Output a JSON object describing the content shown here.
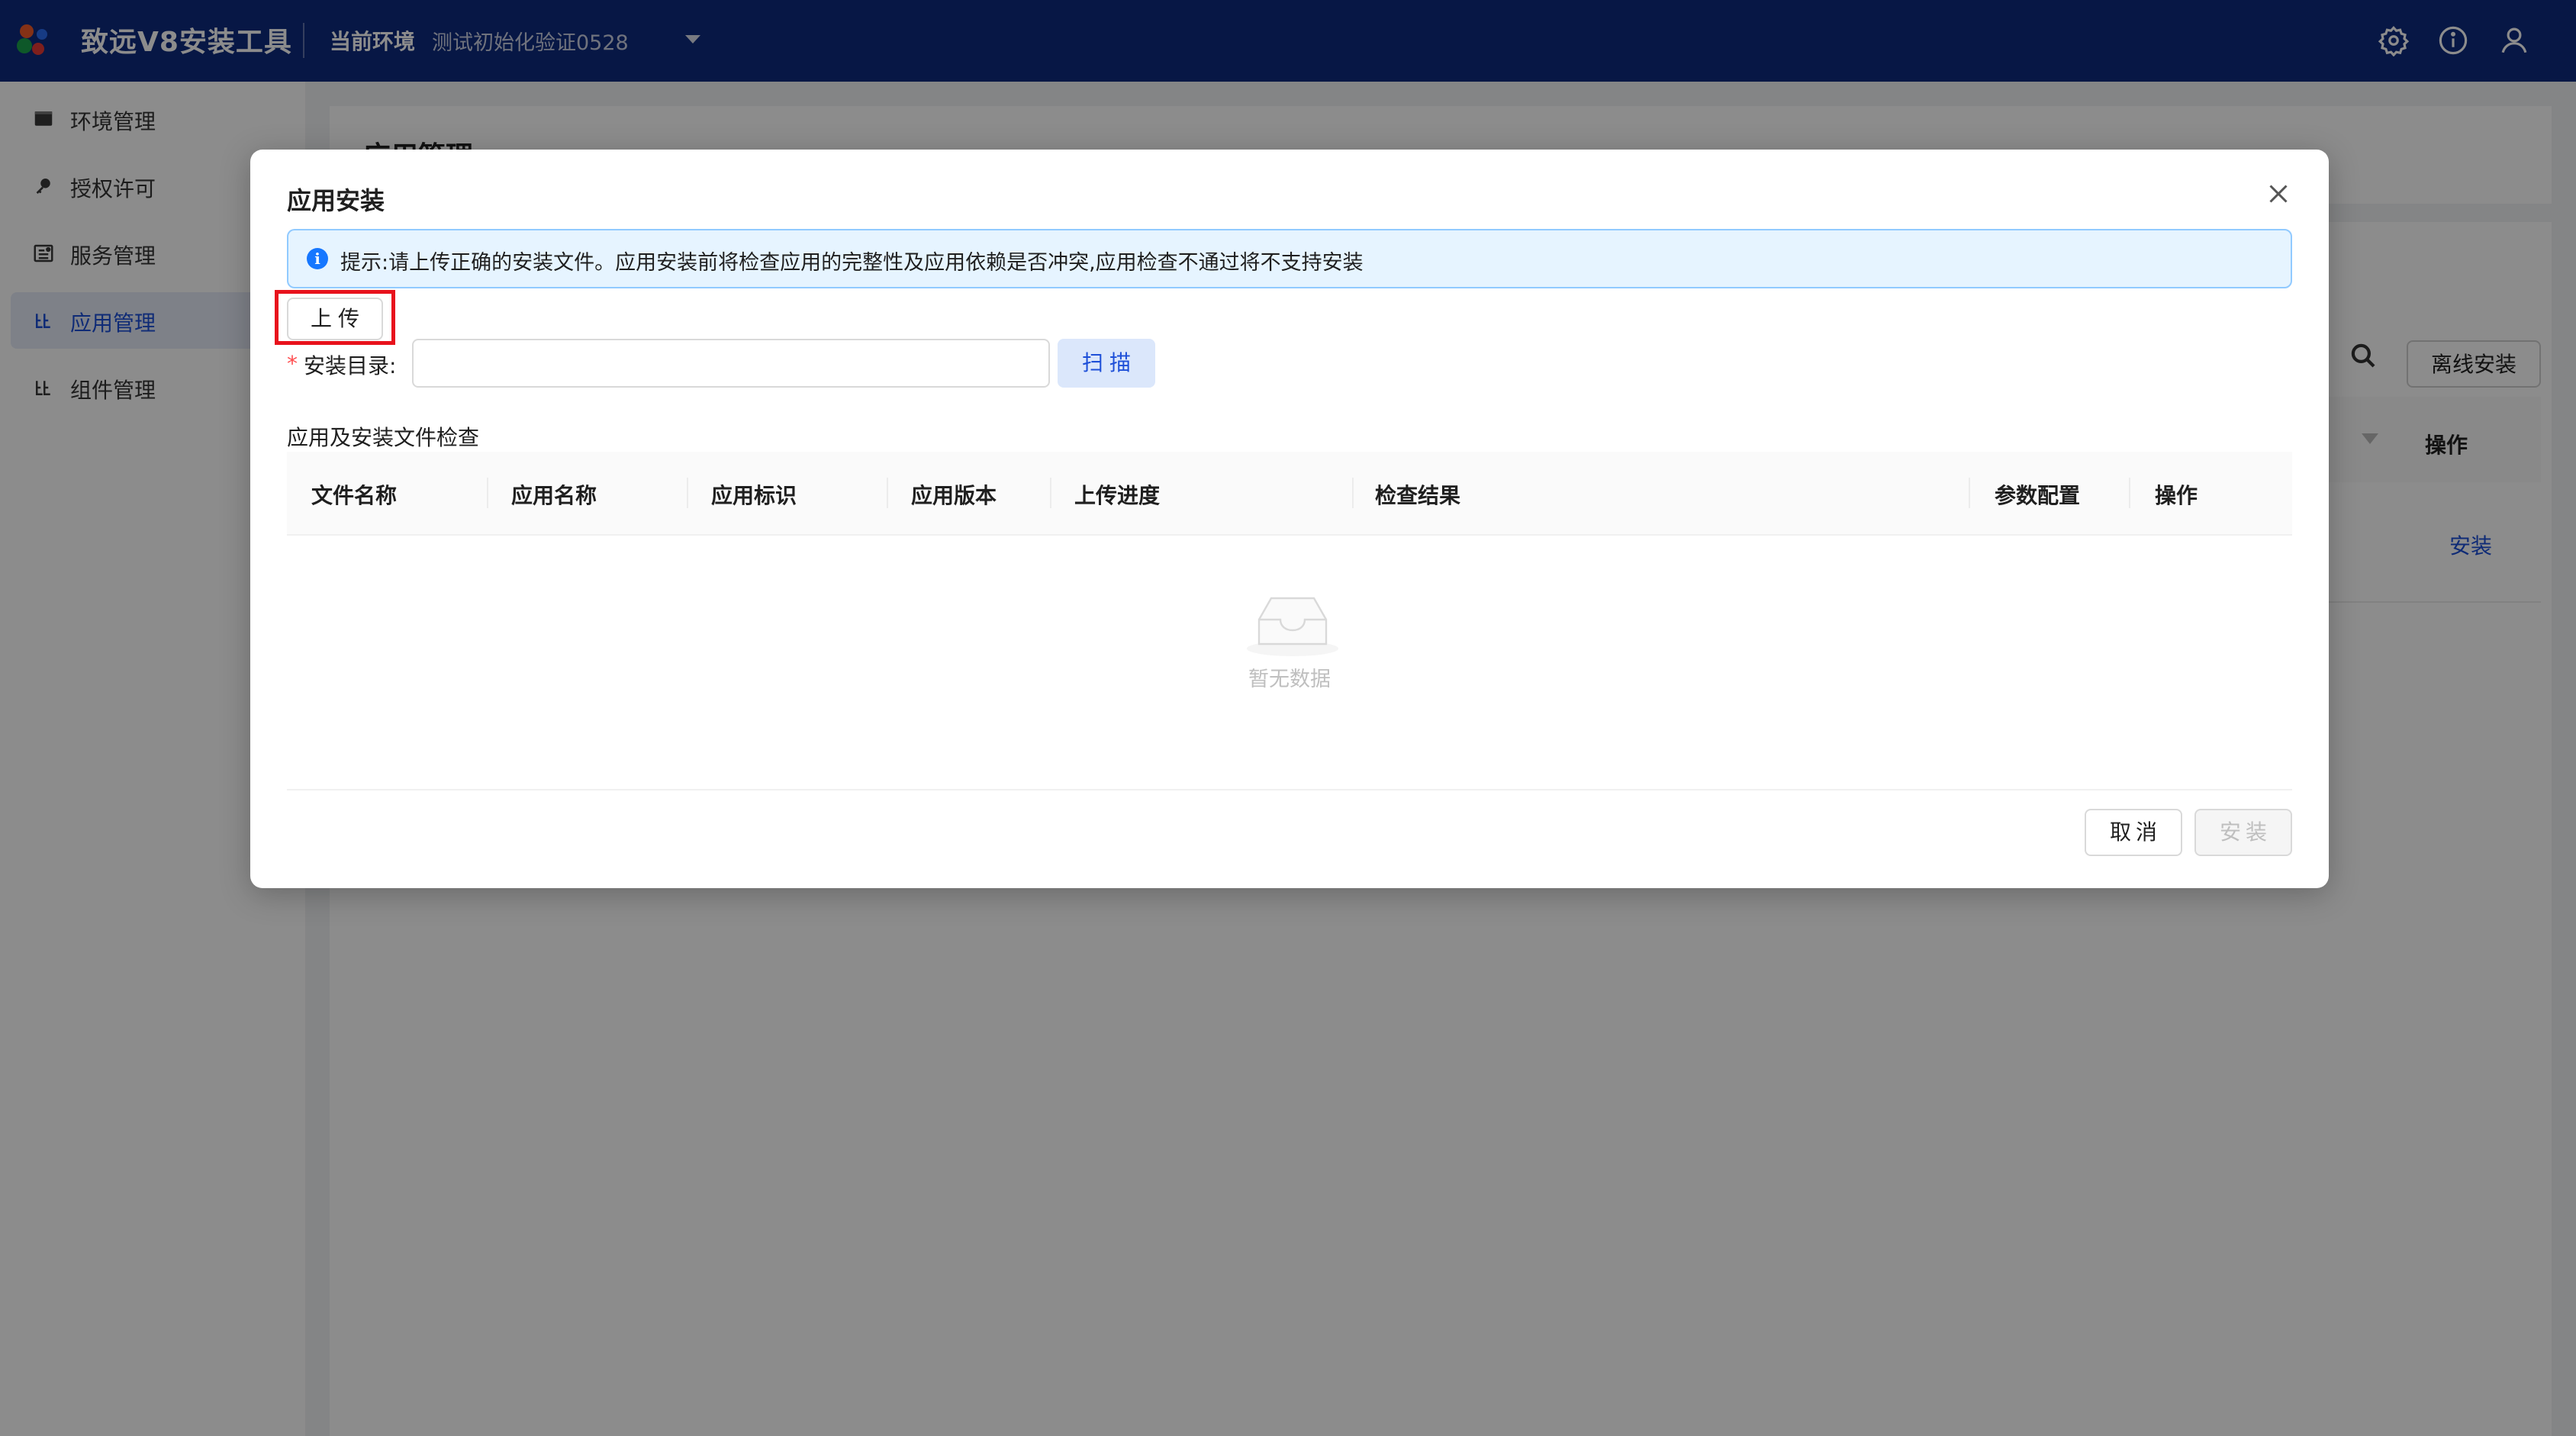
{
  "topbar": {
    "app_title": "致远V8安装工具",
    "env_label": "当前环境",
    "env_value": "测试初始化验证0528",
    "icons": [
      "settings-icon",
      "info-icon",
      "user-icon"
    ],
    "bg_color": "#0e2a7e"
  },
  "sidebar": {
    "items": [
      {
        "label": "环境管理",
        "icon": "monitor-icon",
        "active": false
      },
      {
        "label": "授权许可",
        "icon": "key-icon",
        "active": false
      },
      {
        "label": "服务管理",
        "icon": "service-icon",
        "active": false
      },
      {
        "label": "应用管理",
        "icon": "app-icon",
        "active": true
      },
      {
        "label": "组件管理",
        "icon": "component-icon",
        "active": false
      }
    ],
    "active_color": "#1d4fd8"
  },
  "background_page": {
    "title": "应用管理",
    "offline_install_label": "离线安装",
    "operation_header": "操作",
    "row_action": "安装"
  },
  "modal": {
    "title": "应用安装",
    "alert_text": "提示:请上传正确的安装文件。应用安装前将检查应用的完整性及应用依赖是否冲突,应用检查不通过将不支持安装",
    "upload_label": "上传",
    "dir_label": "安装目录:",
    "dir_value": "",
    "scan_label": "扫描",
    "section_title": "应用及安装文件检查",
    "columns": [
      "文件名称",
      "应用名称",
      "应用标识",
      "应用版本",
      "上传进度",
      "检查结果",
      "参数配置",
      "操作"
    ],
    "empty_text": "暂无数据",
    "cancel_label": "取消",
    "install_label": "安装"
  }
}
